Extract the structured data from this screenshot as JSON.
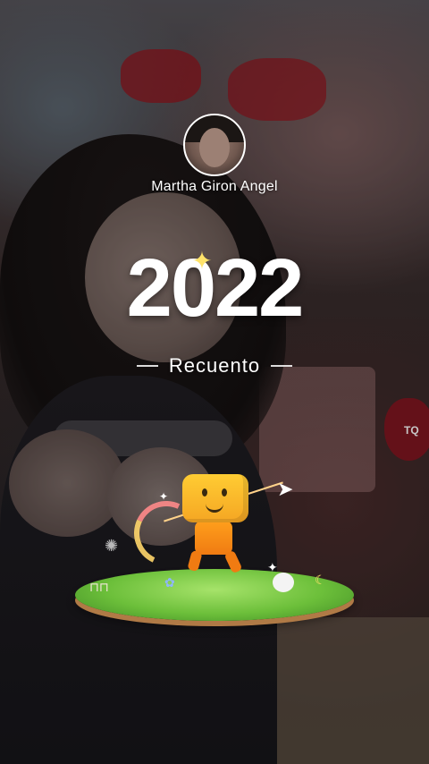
{
  "profile": {
    "name": "Martha Giron Angel"
  },
  "recap": {
    "year": "2022",
    "subtitle": "Recuento"
  },
  "background": {
    "tag_text": "TQ"
  },
  "icons": {
    "sparkle": "✦",
    "plane": "paper-plane-icon",
    "star": "✦"
  }
}
